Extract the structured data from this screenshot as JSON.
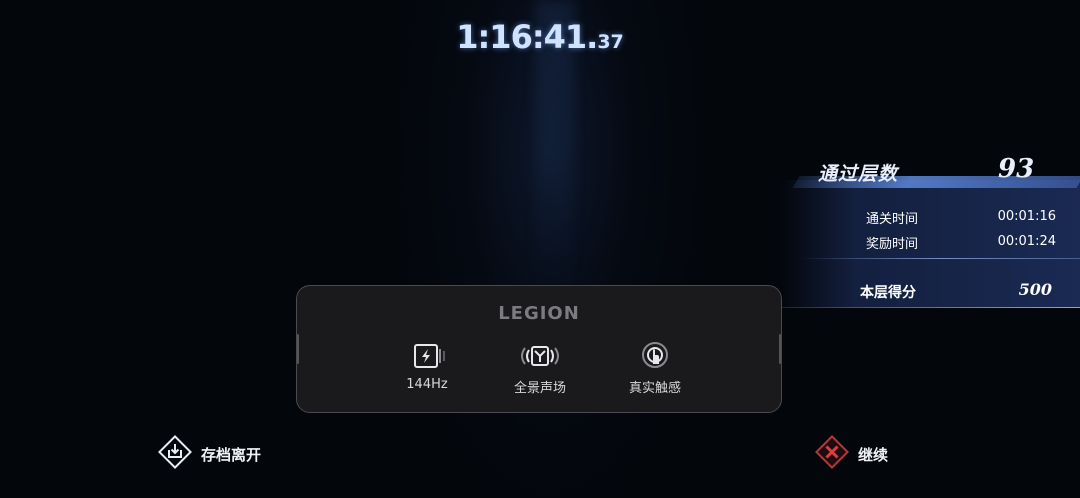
{
  "timer": {
    "main": "1:16:41.",
    "centiseconds": "37"
  },
  "result": {
    "floors_label": "通过层数",
    "floors_value": "93",
    "clear_time_label": "通关时间",
    "clear_time_value": "00:01:16",
    "bonus_time_label": "奖励时间",
    "bonus_time_value": "00:01:24",
    "score_label": "本层得分",
    "score_value": "500"
  },
  "legion": {
    "logo": "LEGION",
    "features": [
      {
        "icon": "refresh-rate-icon",
        "label": "144Hz"
      },
      {
        "icon": "surround-sound-icon",
        "label": "全景声场"
      },
      {
        "icon": "haptic-touch-icon",
        "label": "真实触感"
      }
    ]
  },
  "actions": {
    "save_exit_label": "存档离开",
    "save_exit_icon": "save-download-icon",
    "continue_label": "继续",
    "continue_icon": "continue-x-icon"
  },
  "colors": {
    "continue_icon": "#c03030",
    "panel_accent": "#3a5ea8"
  }
}
